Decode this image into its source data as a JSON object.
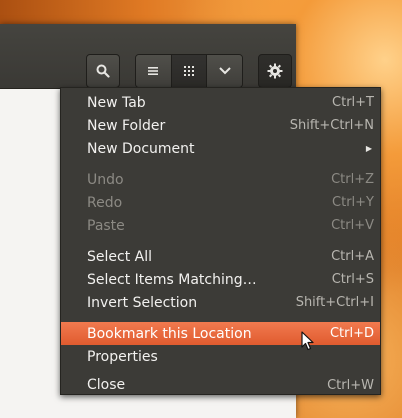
{
  "menu": {
    "items": [
      {
        "label": "New Tab",
        "shortcut": "Ctrl+T"
      },
      {
        "label": "New Folder",
        "shortcut": "Shift+Ctrl+N"
      },
      {
        "label": "New Document",
        "shortcut": ""
      },
      {
        "label": "Undo",
        "shortcut": "Ctrl+Z"
      },
      {
        "label": "Redo",
        "shortcut": "Ctrl+Y"
      },
      {
        "label": "Paste",
        "shortcut": "Ctrl+V"
      },
      {
        "label": "Select All",
        "shortcut": "Ctrl+A"
      },
      {
        "label": "Select Items Matching…",
        "shortcut": "Ctrl+S"
      },
      {
        "label": "Invert Selection",
        "shortcut": "Shift+Ctrl+I"
      },
      {
        "label": "Bookmark this Location",
        "shortcut": "Ctrl+D"
      },
      {
        "label": "Properties",
        "shortcut": ""
      },
      {
        "label": "Close",
        "shortcut": "Ctrl+W"
      }
    ]
  },
  "icons": {
    "search": "search-icon",
    "list_view": "list-view-icon",
    "grid_view": "grid-view-icon",
    "view_options": "chevron-down-icon",
    "gear": "gear-icon",
    "submenu": "submenu-arrow-icon"
  },
  "colors": {
    "highlight": "#e96535",
    "menu_bg": "#3c3b37",
    "headerbar": "#403f3b"
  }
}
